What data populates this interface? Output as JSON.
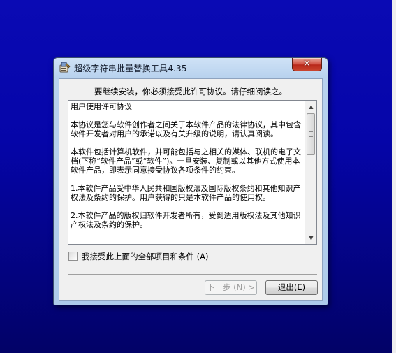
{
  "window": {
    "title": "超级字符串批量替换工具4.35",
    "close_label": "✕"
  },
  "dialog": {
    "instruction": "要继续安装，你必须接受此许可协议。请仔细阅读之。",
    "license_heading": "用户使用许可协议",
    "license_paragraphs": [
      "本协议是您与软件创作者之间关于本软件产品的法律协议，其中包含软件开发者对用户的承诺以及有关升级的说明，请认真阅读。",
      "本软件包括计算机软件，并可能包括与之相关的媒体、联机的电子文档(下称“软件产品”或“软件”)。一旦安装、复制或以其他方式使用本软件产品，即表示同意接受协议各项条件的约束。",
      "1.本软件产品受中华人民共和国版权法及国际版权条约和其他知识产权法及条约的保护。用户获得的只是本软件产品的使用权。",
      "2.本软件产品的版权归软件开发者所有，受到适用版权法及其他知识产权法及条约的保护。"
    ],
    "agree_label": "我接受此上面的全部项目和条件 (A)",
    "agree_checked": false,
    "next_label": "下一步 (N) >",
    "next_enabled": false,
    "exit_label": "退出(E)"
  }
}
